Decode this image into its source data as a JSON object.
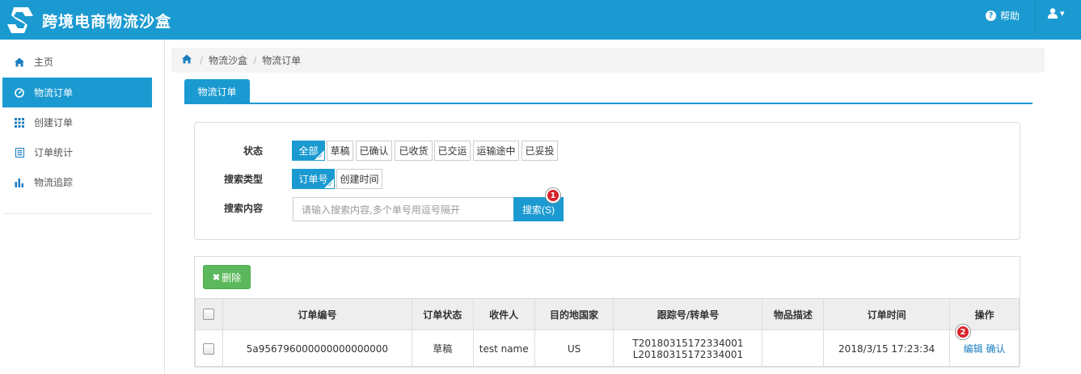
{
  "header": {
    "title": "跨境电商物流沙盒",
    "help_label": "帮助",
    "user_caret": "▾"
  },
  "sidebar": {
    "items": [
      {
        "label": "主页",
        "icon": "home-icon"
      },
      {
        "label": "物流订单",
        "icon": "dashboard-icon",
        "active": true
      },
      {
        "label": "创建订单",
        "icon": "grid-icon"
      },
      {
        "label": "订单统计",
        "icon": "list-icon"
      },
      {
        "label": "物流追踪",
        "icon": "bar-chart-icon"
      }
    ]
  },
  "breadcrumb": {
    "items": [
      "物流沙盒",
      "物流订单"
    ],
    "separator": "/"
  },
  "tab": {
    "label": "物流订单"
  },
  "filters": {
    "status_label": "状态",
    "status_options": [
      "全部",
      "草稿",
      "已确认",
      "已收货",
      "已交运",
      "运输途中",
      "已妥投"
    ],
    "search_type_label": "搜索类型",
    "search_type_options": [
      "订单号",
      "创建时间"
    ],
    "search_content_label": "搜索内容",
    "search_placeholder": "请输入搜索内容,多个单号用逗号隔开",
    "search_button": "搜索(S)"
  },
  "markers": [
    "1",
    "2"
  ],
  "table": {
    "delete_button": "删除",
    "columns": [
      "订单编号",
      "订单状态",
      "收件人",
      "目的地国家",
      "跟踪号/转单号",
      "物品描述",
      "订单时间",
      "操作"
    ],
    "rows": [
      {
        "order_no": "5a956796000000000000000",
        "status": "草稿",
        "recipient": "test name",
        "country": "US",
        "tracking_1": "T20180315172334001",
        "tracking_2": "L20180315172334001",
        "description": "",
        "time": "2018/3/15 17:23:34",
        "actions": [
          "编辑",
          "确认"
        ]
      }
    ]
  },
  "colors": {
    "primary": "#1b9ad1",
    "success": "#5cb85c",
    "marker": "#d9232a"
  }
}
